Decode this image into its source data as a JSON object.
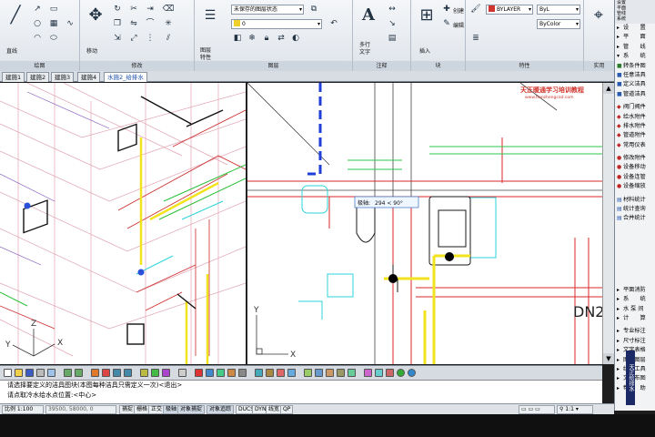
{
  "ribbon": {
    "panels": {
      "draw": "绘图",
      "modify": "修改",
      "layers": "图层",
      "annotation": "注释",
      "block": "块",
      "properties": "特性",
      "utilities": "实用"
    },
    "labels": {
      "line": "直线",
      "move": "移动",
      "layer_properties": "图层\n特性",
      "multiline_text": "多行\n文字",
      "insert": "插入",
      "create": "创建",
      "edit": "编辑"
    },
    "layer_combo": "未保存的图层状态",
    "layer_combo2": "0",
    "bylayer": "BYLAYER",
    "linetype": "ByL",
    "lineweight": "ByColor",
    "color_accent": "#d0342c"
  },
  "tabs": [
    "建施1",
    "建施2",
    "建施3",
    "建施4",
    "水施2_给排水"
  ],
  "active_tab_index": 4,
  "drawing": {
    "watermark": "天正暖通学习培训教程",
    "watermark_url": "www.tianzhengcad.com",
    "tooltip_label": "极轴:",
    "tooltip_value": "294 < 90°",
    "dn_label": "DN2",
    "ucs_left": {
      "z": "Z",
      "y": "Y",
      "x": "X"
    },
    "ucs_right": {
      "y": "Y",
      "x": "X"
    }
  },
  "sidebar": {
    "head": [
      "设置",
      "平面",
      "管线",
      "系统"
    ],
    "items": [
      "设　　置",
      "平　　面",
      "管　　线",
      "系　　统",
      "转条件图",
      "任意洁具",
      "定义洁具",
      "管道洁具",
      "阀门阀件",
      "给水附件",
      "排水附件",
      "管道附件",
      "常用仪表",
      "修改附件",
      "设备移动",
      "设备连管",
      "设备缩放",
      "材料统计",
      "统计查询",
      "合并统计",
      "平面消防",
      "系　　统",
      "水 泵 间",
      "计　　算",
      "专业标注",
      "尺寸标注",
      "文字表格",
      "图库图层",
      "绘图工具",
      "文件布图",
      "帮　　助"
    ],
    "vertical_label": "天正给排水"
  },
  "command": {
    "line1": "请选择要定义的洁具图块(本图每种洁具只需定义一次)<退出>",
    "line2": "请点取冷水给水点位置:<中心>"
  },
  "status": {
    "scale": "比例 1:100",
    "coords": "39500, 58000, 0",
    "buttons": [
      "捕捉",
      "栅格",
      "正交",
      "极轴",
      "对象捕捉",
      "对象追踪",
      "DUCS",
      "DYN",
      "线宽",
      "QP"
    ]
  }
}
